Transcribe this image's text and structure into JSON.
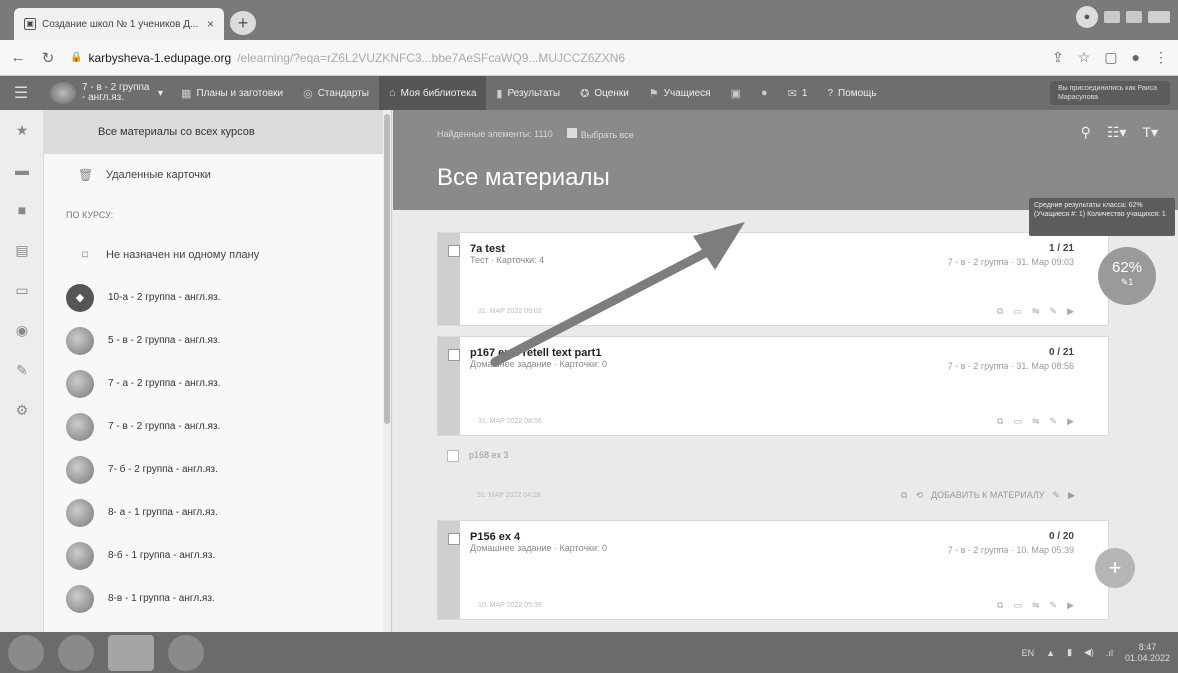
{
  "browser": {
    "tab_title": "Создание школ № 1 учеников Д...",
    "tab_close": "×",
    "new_tab": "+",
    "url_host": "karbysheva-1.edupage.org",
    "url_path": "/elearning/?eqa=rZ6L2VUZKNFC3...bbe7AeSFcaWQ9...MUJCCZ6ZXN6",
    "profile_initial": "●"
  },
  "app": {
    "group_label": "7 - в - 2 группа - англ.яз.",
    "menu_items": [
      {
        "label": "Планы и заготовки",
        "icon": "▦"
      },
      {
        "label": "Стандарты",
        "icon": "◎"
      },
      {
        "label": "Моя библиотека",
        "icon": "⌂"
      },
      {
        "label": "Результаты",
        "icon": "▮"
      },
      {
        "label": "Оценки",
        "icon": "✪"
      },
      {
        "label": "Учащиеся",
        "icon": "⚑"
      }
    ],
    "message_count": "1",
    "help_label": "Помощь",
    "help_icon": "?",
    "user_label": "Вы присоединились как Раиса Марасулова"
  },
  "sidebar": {
    "active_item": "Все материалы со всех курсов",
    "deleted_cards": "Удаленные карточки",
    "section_label": "ПО КУРСУ:",
    "not_assigned": "Не назначен ни одному плану",
    "courses": [
      "10-а - 2 группа - англ.яз.",
      "5 - в - 2 группа - англ.яз.",
      "7 - а - 2 группа - англ.яз.",
      "7 - в - 2 группа - англ.яз.",
      "7- б - 2 группа - англ.яз.",
      "8- а - 1 группа - англ.яз.",
      "8-б - 1 группа - англ.яз.",
      "8-в - 1 группа - англ.яз."
    ]
  },
  "main": {
    "found_text": "Найденные элементы: 1110",
    "select_all": "Выбрать все",
    "title": "Все материалы",
    "cards": [
      {
        "name": "7a test",
        "sub": "Тест · Карточки: 4",
        "score": "1 / 21",
        "meta": "7 - в - 2 группа · 31. Мар 09:03"
      },
      {
        "name": "p167 ex 3 retell text part1",
        "sub": "Домашнее задание · Карточки: 0",
        "score": "0 / 21",
        "meta": "7 - в - 2 группа · 31. Мар 08:56"
      },
      {
        "name": "P156 ex 4",
        "sub": "Домашнее задание · Карточки: 0",
        "score": "0 / 20",
        "meta": "7 - в - 2 группа · 10. Мар 05:39"
      }
    ],
    "plain_item": {
      "name": "p168 ex 3",
      "add_label": "ДОБАВИТЬ К МАТЕРИАЛУ",
      "foot": "31. MAP 2022 04:28"
    },
    "card_foots": [
      "31. MAP 2022 09:03",
      "31. MAP 2022 08:56",
      "10. MAP 2022 05:39"
    ],
    "tooltip": "Средние результаты класса: 62% (Учащиеся #: 1) Количество учащихся: 1",
    "percent": "62%",
    "percent_count": "1",
    "fab": "+"
  },
  "taskbar": {
    "lang": "EN",
    "time": "8:47",
    "date": "01.04.2022"
  }
}
